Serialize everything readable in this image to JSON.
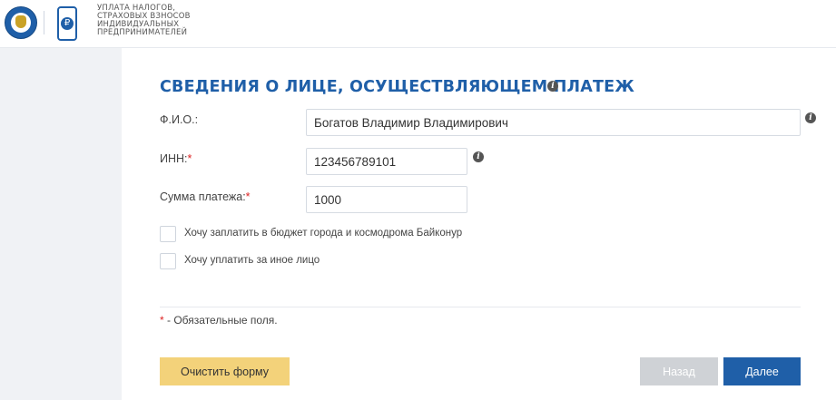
{
  "header": {
    "logo_text_lines": [
      "УПЛАТА НАЛОГОВ,",
      "СТРАХОВЫХ ВЗНОСОВ",
      "ИНДИВИДУАЛЬНЫХ",
      "ПРЕДПРИНИМАТЕЛЕЙ"
    ],
    "coin_symbol": "₽"
  },
  "form": {
    "title": "СВЕДЕНИЯ О ЛИЦЕ, ОСУЩЕСТВЛЯЮЩЕМ ПЛАТЕЖ",
    "fio": {
      "label": "Ф.И.О.:",
      "value": "Богатов Владимир Владимирович"
    },
    "inn": {
      "label": "ИНН:",
      "required_mark": "*",
      "value": "123456789101"
    },
    "amount": {
      "label": "Сумма платежа:",
      "required_mark": "*",
      "value": "1000"
    },
    "checkboxes": [
      {
        "label": "Хочу заплатить в бюджет города и космодрома Байконур",
        "checked": false
      },
      {
        "label": "Хочу уплатить за иное лицо",
        "checked": false
      }
    ],
    "legend": {
      "mark": "*",
      "text": " - Обязательные поля."
    },
    "info_glyph": "i"
  },
  "buttons": {
    "clear": "Очистить форму",
    "back": "Назад",
    "next": "Далее"
  },
  "colors": {
    "brand_blue": "#1f5fa8",
    "required_red": "#dd2222",
    "clear_button": "#f3d27a",
    "back_button_disabled": "#cfd2d6"
  }
}
